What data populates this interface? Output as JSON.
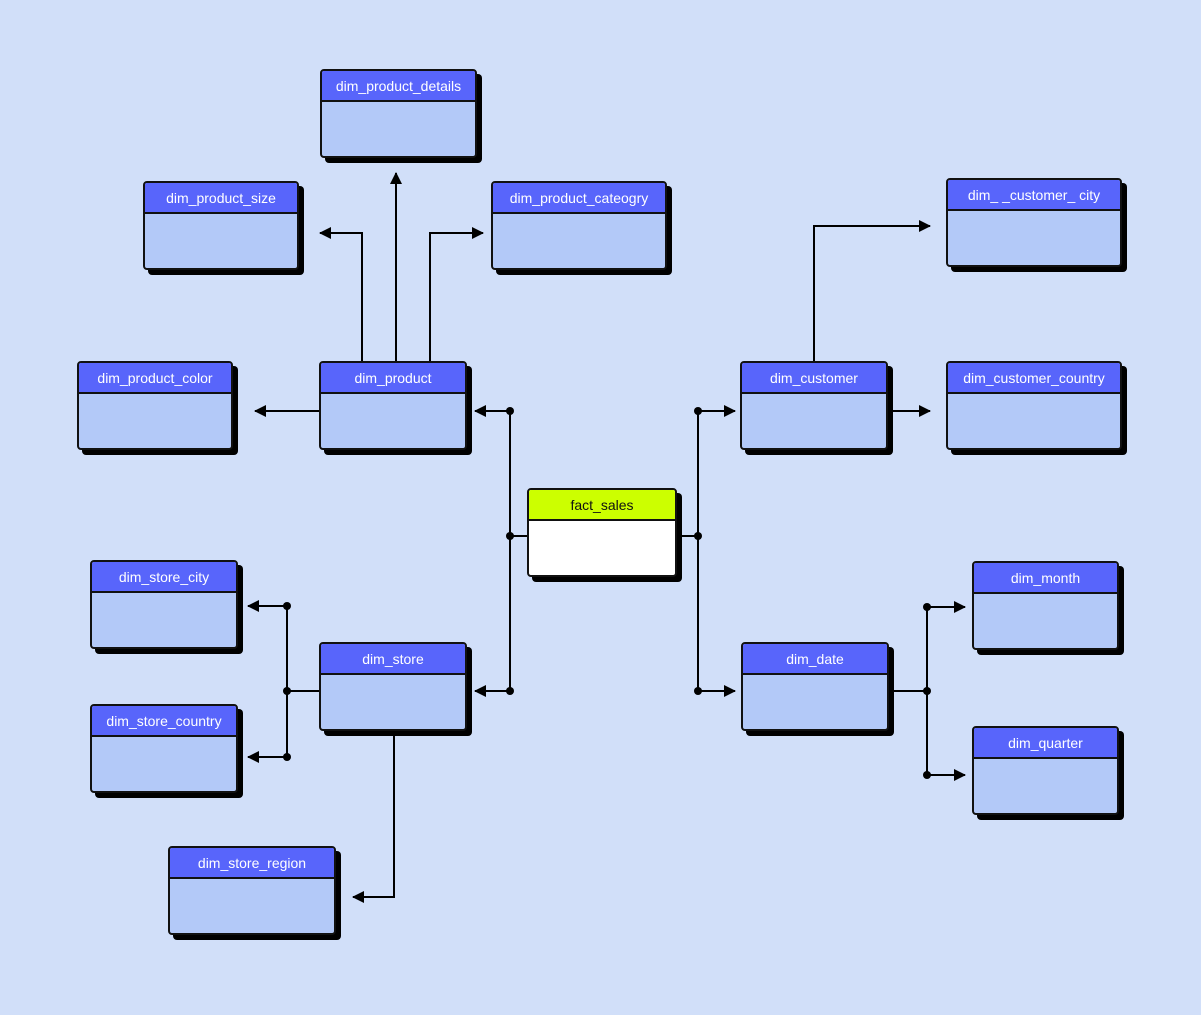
{
  "diagram": {
    "type": "star-schema-snowflake",
    "colors": {
      "background": "#d1dff9",
      "dimension_header": "#5865fb",
      "dimension_body": "#b3c9f8",
      "fact_header": "#ccff00",
      "fact_body": "#ffffff",
      "border": "#111111"
    },
    "entities": {
      "fact_sales": "fact_sales",
      "dim_product": "dim_product",
      "dim_product_details": "dim_product_details",
      "dim_product_size": "dim_product_size",
      "dim_product_cateogry": "dim_product_cateogry",
      "dim_product_color": "dim_product_color",
      "dim_store": "dim_store",
      "dim_store_city": "dim_store_city",
      "dim_store_country": "dim_store_country",
      "dim_store_region": "dim_store_region",
      "dim_customer": "dim_customer",
      "dim_customer_city": "dim_ _customer_ city",
      "dim_customer_country": "dim_customer_country",
      "dim_date": "dim_date",
      "dim_month": "dim_month",
      "dim_quarter": "dim_quarter"
    },
    "relationships": [
      {
        "from": "fact_sales",
        "to": "dim_product"
      },
      {
        "from": "fact_sales",
        "to": "dim_store"
      },
      {
        "from": "fact_sales",
        "to": "dim_customer"
      },
      {
        "from": "fact_sales",
        "to": "dim_date"
      },
      {
        "from": "dim_product",
        "to": "dim_product_details"
      },
      {
        "from": "dim_product",
        "to": "dim_product_size"
      },
      {
        "from": "dim_product",
        "to": "dim_product_cateogry"
      },
      {
        "from": "dim_product",
        "to": "dim_product_color"
      },
      {
        "from": "dim_store",
        "to": "dim_store_city"
      },
      {
        "from": "dim_store",
        "to": "dim_store_country"
      },
      {
        "from": "dim_store",
        "to": "dim_store_region"
      },
      {
        "from": "dim_customer",
        "to": "dim_customer_city"
      },
      {
        "from": "dim_customer",
        "to": "dim_customer_country"
      },
      {
        "from": "dim_date",
        "to": "dim_month"
      },
      {
        "from": "dim_date",
        "to": "dim_quarter"
      }
    ]
  }
}
